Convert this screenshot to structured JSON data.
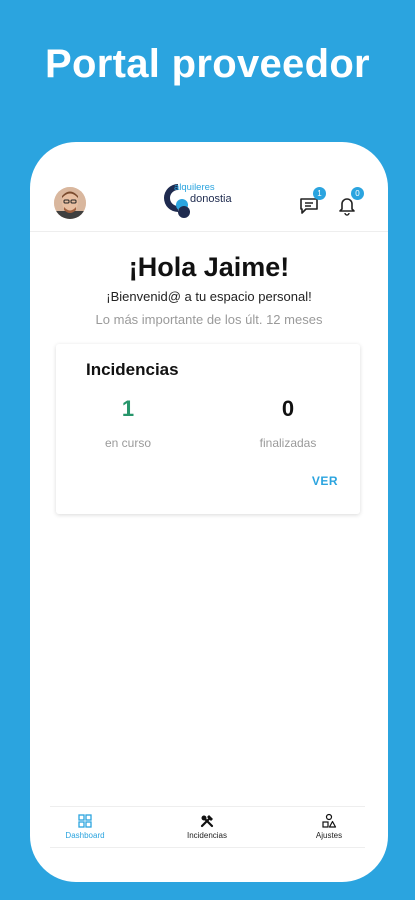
{
  "promo": {
    "title": "Portal proveedor"
  },
  "header": {
    "logo": {
      "line1": "alquileres",
      "line2": "donostia"
    },
    "messages_badge": "1",
    "notifications_badge": "0"
  },
  "main": {
    "greeting": "¡Hola Jaime!",
    "welcome": "¡Bienvenid@ a tu espacio personal!",
    "period": "Lo más importante de los últ. 12 meses"
  },
  "incidencias_card": {
    "title": "Incidencias",
    "in_progress": {
      "value": "1",
      "label": "en curso"
    },
    "finished": {
      "value": "0",
      "label": "finalizadas"
    },
    "link": "VER"
  },
  "bottom_nav": {
    "items": [
      {
        "label": "Dashboard",
        "icon": "dashboard-grid-icon",
        "active": true
      },
      {
        "label": "Incidencias",
        "icon": "tools-icon",
        "active": false
      },
      {
        "label": "Ajustes",
        "icon": "settings-shapes-icon",
        "active": false
      }
    ]
  },
  "colors": {
    "background": "#2ba4df",
    "accent": "#2ba4df",
    "positive": "#27966b",
    "logo_dark": "#1f2b4f"
  }
}
